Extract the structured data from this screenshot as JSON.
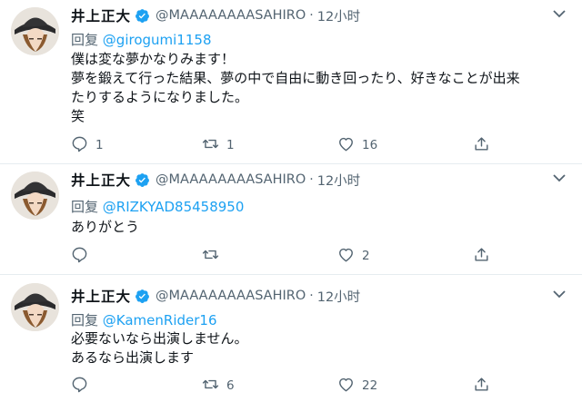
{
  "tweets": [
    {
      "name": "井上正大",
      "handle": "@MAAAAAAAASAHIRO",
      "separator": "·",
      "time": "12小时",
      "reply_prefix": "回复",
      "reply_to": "@girogumi1158",
      "body": "僕は変な夢かなりみます！\n夢を鍛えて行った結果、夢の中で自由に動き回ったり、好きなことが出来\nたりするようになりました。\n笑",
      "replies": "1",
      "retweets": "1",
      "likes": "16"
    },
    {
      "name": "井上正大",
      "handle": "@MAAAAAAAASAHIRO",
      "separator": "·",
      "time": "12小时",
      "reply_prefix": "回复",
      "reply_to": "@RIZKYAD85458950",
      "body": "ありがとう",
      "replies": "",
      "retweets": "",
      "likes": "2"
    },
    {
      "name": "井上正大",
      "handle": "@MAAAAAAAASAHIRO",
      "separator": "·",
      "time": "12小时",
      "reply_prefix": "回复",
      "reply_to": "@KamenRider16",
      "body": "必要ないなら出演しません。\nあるなら出演します",
      "replies": "",
      "retweets": "6",
      "likes": "22"
    }
  ],
  "icons": {
    "verified": "verified-badge-icon",
    "more": "chevron-down-icon",
    "reply": "reply-icon",
    "retweet": "retweet-icon",
    "like": "heart-icon",
    "share": "share-icon"
  },
  "colors": {
    "link": "#1da1f2",
    "secondary_text": "#536471",
    "verified": "#1da1f2",
    "divider": "#e6ecf0"
  }
}
